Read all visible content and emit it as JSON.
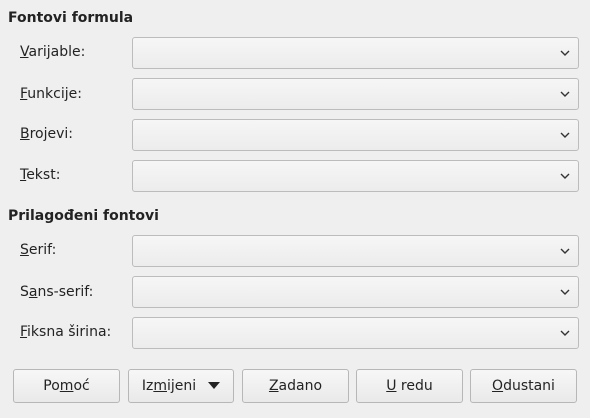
{
  "formula_fonts": {
    "title": "Fontovi formula",
    "rows": [
      {
        "label_ul": "V",
        "label_rest": "arijable:",
        "value": ""
      },
      {
        "label_ul": "F",
        "label_rest": "unkcije:",
        "value": ""
      },
      {
        "label_ul": "B",
        "label_rest": "rojevi:",
        "value": ""
      },
      {
        "label_ul": "T",
        "label_rest": "ekst:",
        "value": ""
      }
    ]
  },
  "custom_fonts": {
    "title": "Prilagođeni fontovi",
    "rows": [
      {
        "label_ul": "S",
        "label_rest": "erif:",
        "value": ""
      },
      {
        "label_pre": "S",
        "label_ul": "a",
        "label_rest": "ns-serif:",
        "value": ""
      },
      {
        "label_ul": "F",
        "label_rest": "iksna širina:",
        "value": ""
      }
    ]
  },
  "buttons": {
    "help_pre": "Po",
    "help_ul": "m",
    "help_rest": "oć",
    "modify_pre": "Iz",
    "modify_ul": "m",
    "modify_rest": "ijeni",
    "default_ul": "Z",
    "default_rest": "adano",
    "ok_ul": "U",
    "ok_rest": " redu",
    "cancel_ul": "O",
    "cancel_rest": "dustani"
  },
  "icons": {
    "combo_arrow": "chevron-down-icon",
    "modify_arrow": "triangle-down-icon"
  }
}
